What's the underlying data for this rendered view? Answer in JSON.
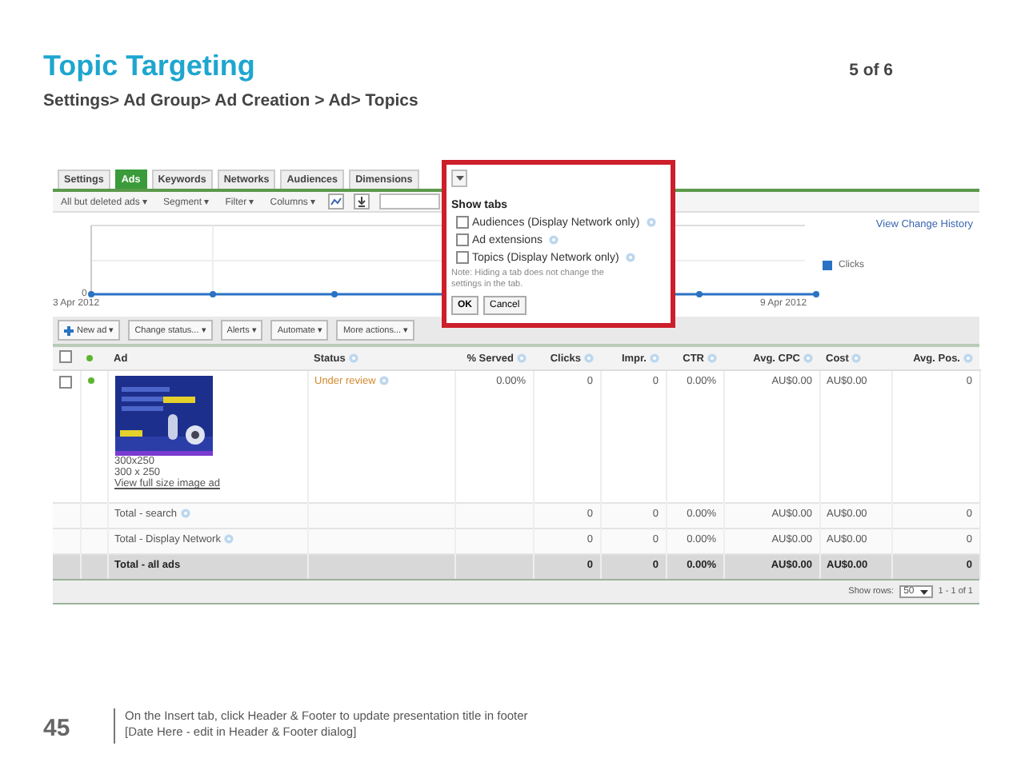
{
  "slide": {
    "title": "Topic Targeting",
    "breadcrumb": "Settings> Ad Group> Ad Creation > Ad> Topics",
    "page_counter": "5 of 6",
    "slide_number": "45",
    "footer_lines": [
      "On the Insert tab, click Header & Footer to update presentation title in footer",
      "[Date Here - edit in Header & Footer dialog]"
    ]
  },
  "screenshot": {
    "tabs": [
      {
        "label": "Settings",
        "selected": false
      },
      {
        "label": "Ads",
        "selected": true
      },
      {
        "label": "Keywords",
        "selected": false
      },
      {
        "label": "Networks",
        "selected": false
      },
      {
        "label": "Audiences",
        "selected": false
      },
      {
        "label": "Dimensions",
        "selected": false
      }
    ],
    "toolbar": [
      {
        "kind": "menu",
        "label": "All but deleted ads ▾"
      },
      {
        "kind": "menu",
        "label": "Segment ▾"
      },
      {
        "kind": "menu",
        "label": "Filter ▾"
      },
      {
        "kind": "menu",
        "label": "Columns ▾"
      },
      {
        "kind": "chart"
      },
      {
        "kind": "download"
      },
      {
        "kind": "field"
      }
    ],
    "chart": {
      "link": "View Change History",
      "legend": "Clicks",
      "y_label": "0",
      "start_date": "3 Apr 2012",
      "end_date": "9 Apr 2012"
    },
    "actions": [
      {
        "kind": "new",
        "label": "New ad ▾"
      },
      {
        "kind": "menu",
        "label": "Change status... ▾"
      },
      {
        "kind": "menu",
        "label": "Alerts ▾"
      },
      {
        "kind": "menu",
        "label": "Automate ▾"
      },
      {
        "kind": "menu",
        "label": "More actions... ▾"
      }
    ],
    "table": {
      "select_all": {
        "checked": false
      },
      "header_dot": {
        "color": "#5cb531"
      },
      "columns": [
        {
          "kind": "text",
          "label": "Ad",
          "help": false
        },
        {
          "kind": "text",
          "label": "Status",
          "help": true
        },
        {
          "kind": "num",
          "label": "% Served",
          "help": true
        },
        {
          "kind": "num",
          "label": "Clicks",
          "help": true
        },
        {
          "kind": "num",
          "label": "Impr.",
          "help": true
        },
        {
          "kind": "num",
          "label": "CTR",
          "help": true
        },
        {
          "kind": "num",
          "label": "Avg. CPC",
          "help": true
        },
        {
          "kind": "text",
          "label": "Cost",
          "help": true
        },
        {
          "kind": "num",
          "label": "Avg. Pos.",
          "help": true
        }
      ],
      "rows": [
        {
          "checked": false,
          "color": "#5cb531",
          "status_help": true,
          "cells": [
            {
              "kind": "picture",
              "size": "300x250",
              "dimensions": "300 x 250",
              "link": "View full size image ad"
            },
            "Under review",
            "0.00%",
            "0",
            "0",
            "0.00%",
            "AU$0.00",
            "AU$0.00",
            "0"
          ]
        }
      ],
      "totals": [
        {
          "help": true,
          "emphasis": false,
          "cells": [
            "Total - search",
            "",
            "",
            "0",
            "0",
            "0.00%",
            "AU$0.00",
            "AU$0.00",
            "0"
          ]
        },
        {
          "help": true,
          "emphasis": false,
          "cells": [
            "Total - Display Network",
            "",
            "",
            "0",
            "0",
            "0.00%",
            "AU$0.00",
            "AU$0.00",
            "0"
          ]
        },
        {
          "help": false,
          "emphasis": true,
          "cells": [
            "Total - all ads",
            "",
            "",
            "0",
            "0",
            "0.00%",
            "AU$0.00",
            "AU$0.00",
            "0"
          ]
        }
      ]
    },
    "pagination": {
      "label": "Show rows:",
      "rows_value": "50",
      "range": "1 - 1 of 1"
    },
    "popup": {
      "highlighted": true,
      "title": "Show tabs",
      "options": [
        {
          "label": "Audiences (Display Network only)",
          "checked": false
        },
        {
          "label": "Ad extensions",
          "checked": false
        },
        {
          "label": "Topics (Display Network only)",
          "checked": false
        }
      ],
      "note": "Note: Hiding a tab does not change the settings in the tab.",
      "buttons": [
        "OK",
        "Cancel"
      ]
    }
  }
}
